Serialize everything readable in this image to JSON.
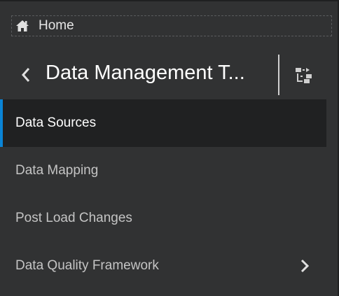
{
  "breadcrumb": {
    "home_label": "Home",
    "icon": "home-icon"
  },
  "header": {
    "title": "Data Management T...",
    "back_icon": "chevron-left-icon",
    "switch_icon": "switch-hierarchy-icon"
  },
  "nav": {
    "items": [
      {
        "label": "Data Sources",
        "active": true
      },
      {
        "label": "Data Mapping",
        "active": false
      },
      {
        "label": "Post Load Changes",
        "active": false
      },
      {
        "label": "Data Quality Framework",
        "active": false,
        "has_children": true
      }
    ]
  },
  "colors": {
    "background": "#313233",
    "active_item_background": "#202122",
    "active_indicator": "#0a84d6",
    "text_primary": "#ffffff",
    "text_secondary": "#c4c4c4"
  }
}
